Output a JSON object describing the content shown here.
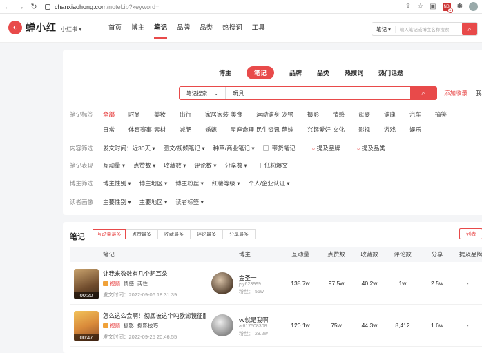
{
  "browser": {
    "url_host": "chanxiaohong.com",
    "url_path": "/noteLib?keyword=",
    "ext_label": "NB",
    "ext_badge": "1"
  },
  "header": {
    "logo_text": "蝉小红",
    "brand_select": "小红书 ▾",
    "nav": [
      "首页",
      "博主",
      "笔记",
      "品牌",
      "品类",
      "热搜词",
      "工具"
    ],
    "search_type": "笔记 ▾",
    "search_placeholder": "输入笔记或博主名称搜索"
  },
  "panel": {
    "tabs": [
      "博主",
      "笔记",
      "品牌",
      "品类",
      "热搜词",
      "热门话题"
    ],
    "search_type": "笔记搜索",
    "search_value": "玩具",
    "links": {
      "add": "添加收录",
      "right": "我"
    },
    "tag_label": "笔记标签",
    "tags_row1": [
      "全部",
      "时尚",
      "美妆",
      "出行",
      "家居家装",
      "美食",
      "运动健身",
      "宠物",
      "摄影",
      "情感",
      "母婴",
      "健康",
      "汽车",
      "搞笑"
    ],
    "tags_row2": [
      "日常",
      "体育赛事",
      "素材",
      "减肥",
      "婚嫁",
      "星座命理",
      "民生资讯",
      "萌娃",
      "兴趣爱好",
      "文化",
      "影视",
      "游戏",
      "娱乐"
    ],
    "content_label": "内容筛选",
    "content_filters": [
      "发文时间：近30天 ▾",
      "图文/视频笔记 ▾",
      "种草/商业笔记 ▾"
    ],
    "content_check": "带货笔记",
    "content_red1": "提及品牌",
    "content_red2": "提及品类",
    "perf_label": "笔记表现",
    "perf_filters": [
      "互动量 ▾",
      "点赞数 ▾",
      "收藏数 ▾",
      "评论数 ▾",
      "分享数 ▾"
    ],
    "perf_check": "低粉爆文",
    "blogger_label": "博主筛选",
    "blogger_filters": [
      "博主性别 ▾",
      "博主地区 ▾",
      "博主粉丝 ▾",
      "红薯等级 ▾",
      "个人/企业认证 ▾"
    ],
    "reader_label": "读者画像",
    "reader_filters": [
      "主要性别 ▾",
      "主要地区 ▾",
      "读者标签 ▾"
    ]
  },
  "results": {
    "title": "笔记",
    "sort_tabs": [
      "互动量最多",
      "点赞最多",
      "收藏最多",
      "评论最多",
      "分享最多"
    ],
    "list_btn": "列表",
    "columns": [
      "笔记",
      "博主",
      "互动量",
      "点赞数",
      "收藏数",
      "评论数",
      "分享",
      "提及品牌"
    ],
    "rows": [
      {
        "duration": "00:20",
        "title": "让我来数数有几个耙耳朵",
        "type": "视频",
        "tags": [
          "情感",
          "两性"
        ],
        "date": "发文时间：2022-09-06 18:31:39",
        "blogger": "金圣一",
        "blogger_id": "jsy623999",
        "fans": "粉丝：  56w",
        "interact": "138.7w",
        "likes": "97.5w",
        "collects": "40.2w",
        "comments": "1w",
        "shares": "2.5w",
        "brand": "-"
      },
      {
        "duration": "00:47",
        "title": "怎么这么会啊！彻底被这个吨欧滤镜征服...",
        "type": "视频",
        "tags": [
          "摄影",
          "摄影技巧"
        ],
        "date": "发文时间：2022-09-25 20:46:55",
        "blogger": "vv就是我啊",
        "blogger_id": "aj617508308",
        "fans": "粉丝：  28.2w",
        "interact": "120.1w",
        "likes": "75w",
        "collects": "44.3w",
        "comments": "8,412",
        "shares": "1.6w",
        "brand": "-"
      }
    ]
  }
}
